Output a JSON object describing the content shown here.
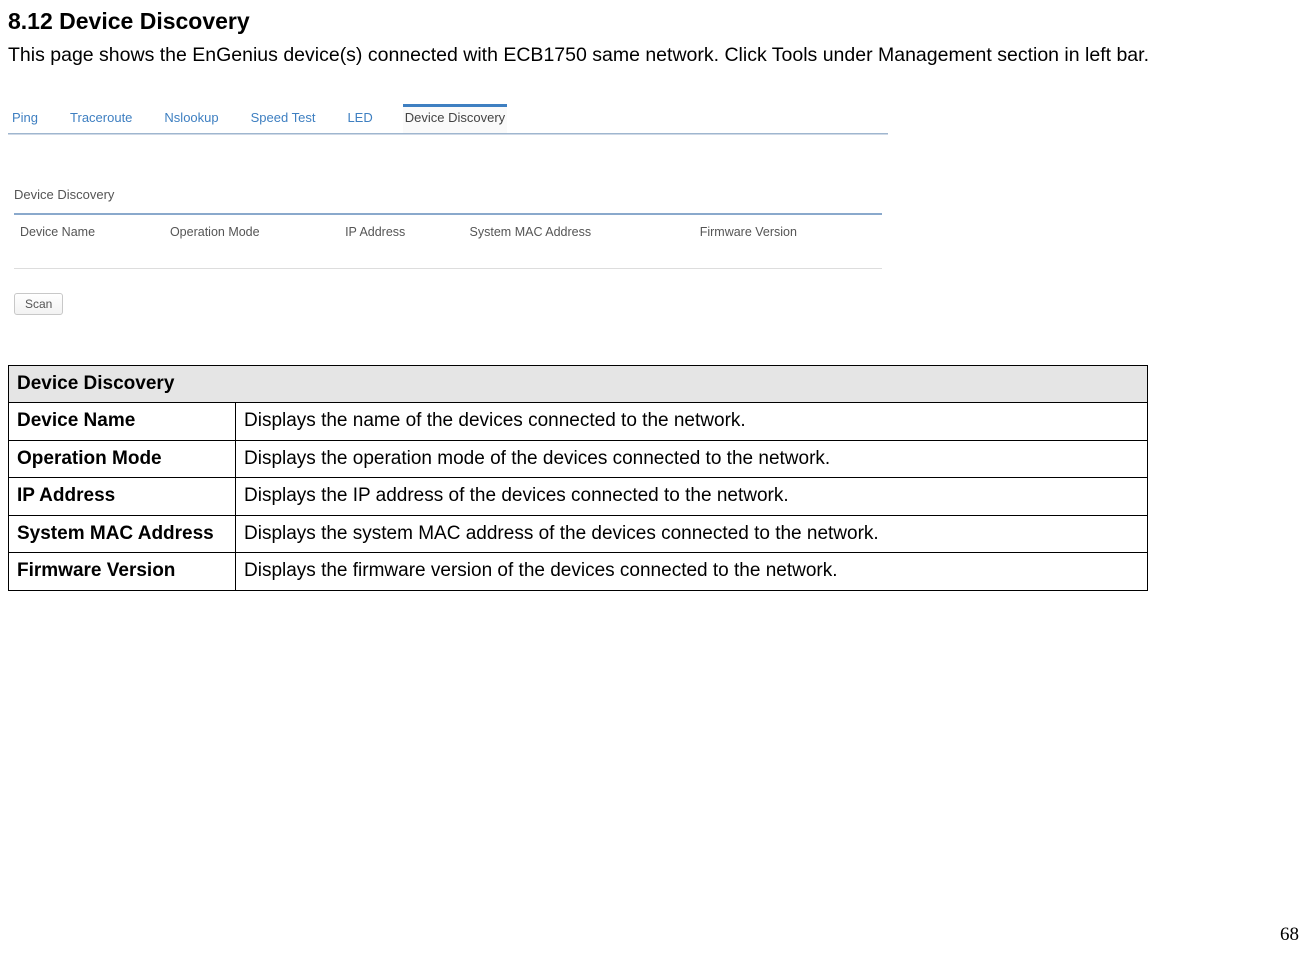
{
  "section": {
    "title": "8.12 Device Discovery",
    "intro": "This page shows the EnGenius device(s) connected with ECB1750 same network. Click Tools under Management section in left bar."
  },
  "ui": {
    "tabs": [
      {
        "label": "Ping"
      },
      {
        "label": "Traceroute"
      },
      {
        "label": "Nslookup"
      },
      {
        "label": "Speed Test"
      },
      {
        "label": "LED"
      },
      {
        "label": "Device Discovery",
        "active": true
      }
    ],
    "panel_title": "Device Discovery",
    "columns": [
      "Device Name",
      "Operation Mode",
      "IP Address",
      "System MAC Address",
      "Firmware Version"
    ],
    "scan_label": "Scan"
  },
  "doc_table": {
    "header": "Device Discovery",
    "rows": [
      {
        "term": "Device Name",
        "desc": "Displays the name of the devices connected to the network."
      },
      {
        "term": "Operation Mode",
        "desc": "Displays the operation mode of the devices connected to the network."
      },
      {
        "term": "IP Address",
        "desc": "Displays the IP address of the devices connected to the network."
      },
      {
        "term": "System MAC Address",
        "desc": "Displays the system MAC address of the devices connected to the network."
      },
      {
        "term": "Firmware Version",
        "desc": "Displays the firmware version of the devices connected to the network."
      }
    ]
  },
  "page_number": "68"
}
